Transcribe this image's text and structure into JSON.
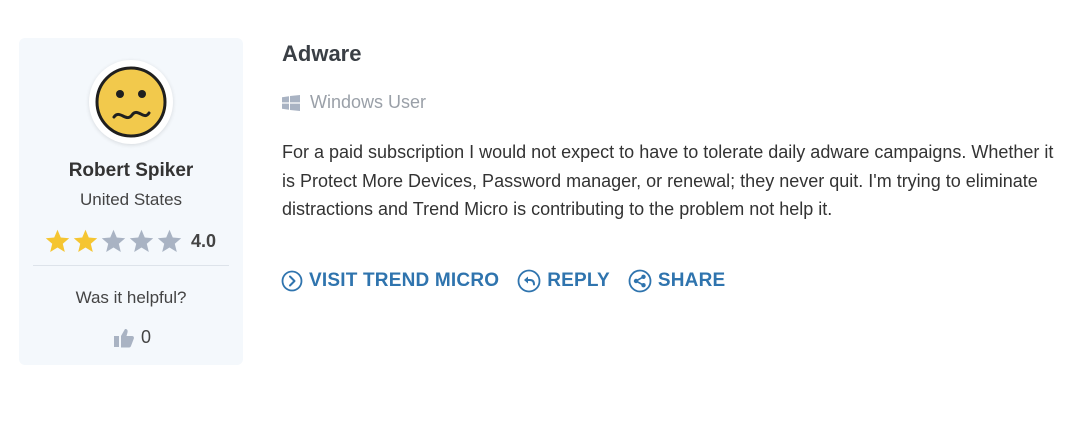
{
  "reviewer": {
    "name": "Robert Spiker",
    "country": "United States",
    "rating_value": 2,
    "rating_max": 5,
    "rating_label": "4.0",
    "avatar_icon": "sad-face-icon"
  },
  "feedback": {
    "prompt": "Was it helpful?",
    "likes": "0"
  },
  "review": {
    "title": "Adware",
    "platform": "Windows User",
    "text": "For a paid subscription I would not expect to have to tolerate daily adware campaigns. Whether it is Protect More Devices, Password manager, or renewal; they never quit. I'm trying to eliminate distractions and Trend Micro is contributing to the problem not help it."
  },
  "actions": {
    "visit_label": "VISIT TREND MICRO",
    "reply_label": "REPLY",
    "share_label": "SHARE"
  },
  "colors": {
    "accent": "#2f74ae",
    "star_filled": "#f5c531",
    "star_empty": "#a9b3c3",
    "card_bg": "#f4f8fc"
  }
}
